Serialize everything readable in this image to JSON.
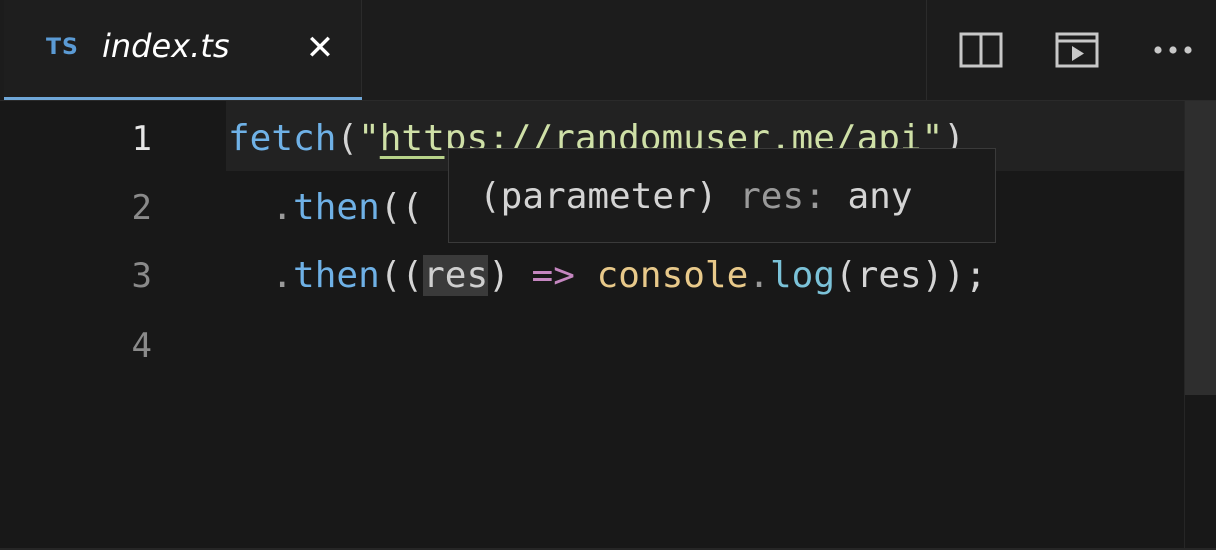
{
  "tab": {
    "language_badge": "TS",
    "filename": "index.ts",
    "close_glyph": "✕",
    "accent_color": "#6fa7d8"
  },
  "actions": [
    {
      "name": "split-editor-icon"
    },
    {
      "name": "open-preview-icon"
    },
    {
      "name": "more-actions-icon"
    }
  ],
  "gutter": [
    "1",
    "2",
    "3",
    "4"
  ],
  "code": {
    "line1": {
      "fn": "fetch",
      "open": "(",
      "quote_open": "\"",
      "url": "https://randomuser.me/api",
      "quote_close": "\"",
      "close": ")"
    },
    "line2": {
      "indent": "  ",
      "dot": ".",
      "method": "then",
      "rest": "(("
    },
    "line3": {
      "indent": "  ",
      "dot": ".",
      "method": "then",
      "open": "((",
      "param": "res",
      "close": ")",
      "arrow": "=>",
      "obj": "console",
      "dot2": ".",
      "log": "log",
      "args": "(res));"
    }
  },
  "hover": {
    "prefix": "(parameter)",
    "name": "res:",
    "type": "any"
  }
}
